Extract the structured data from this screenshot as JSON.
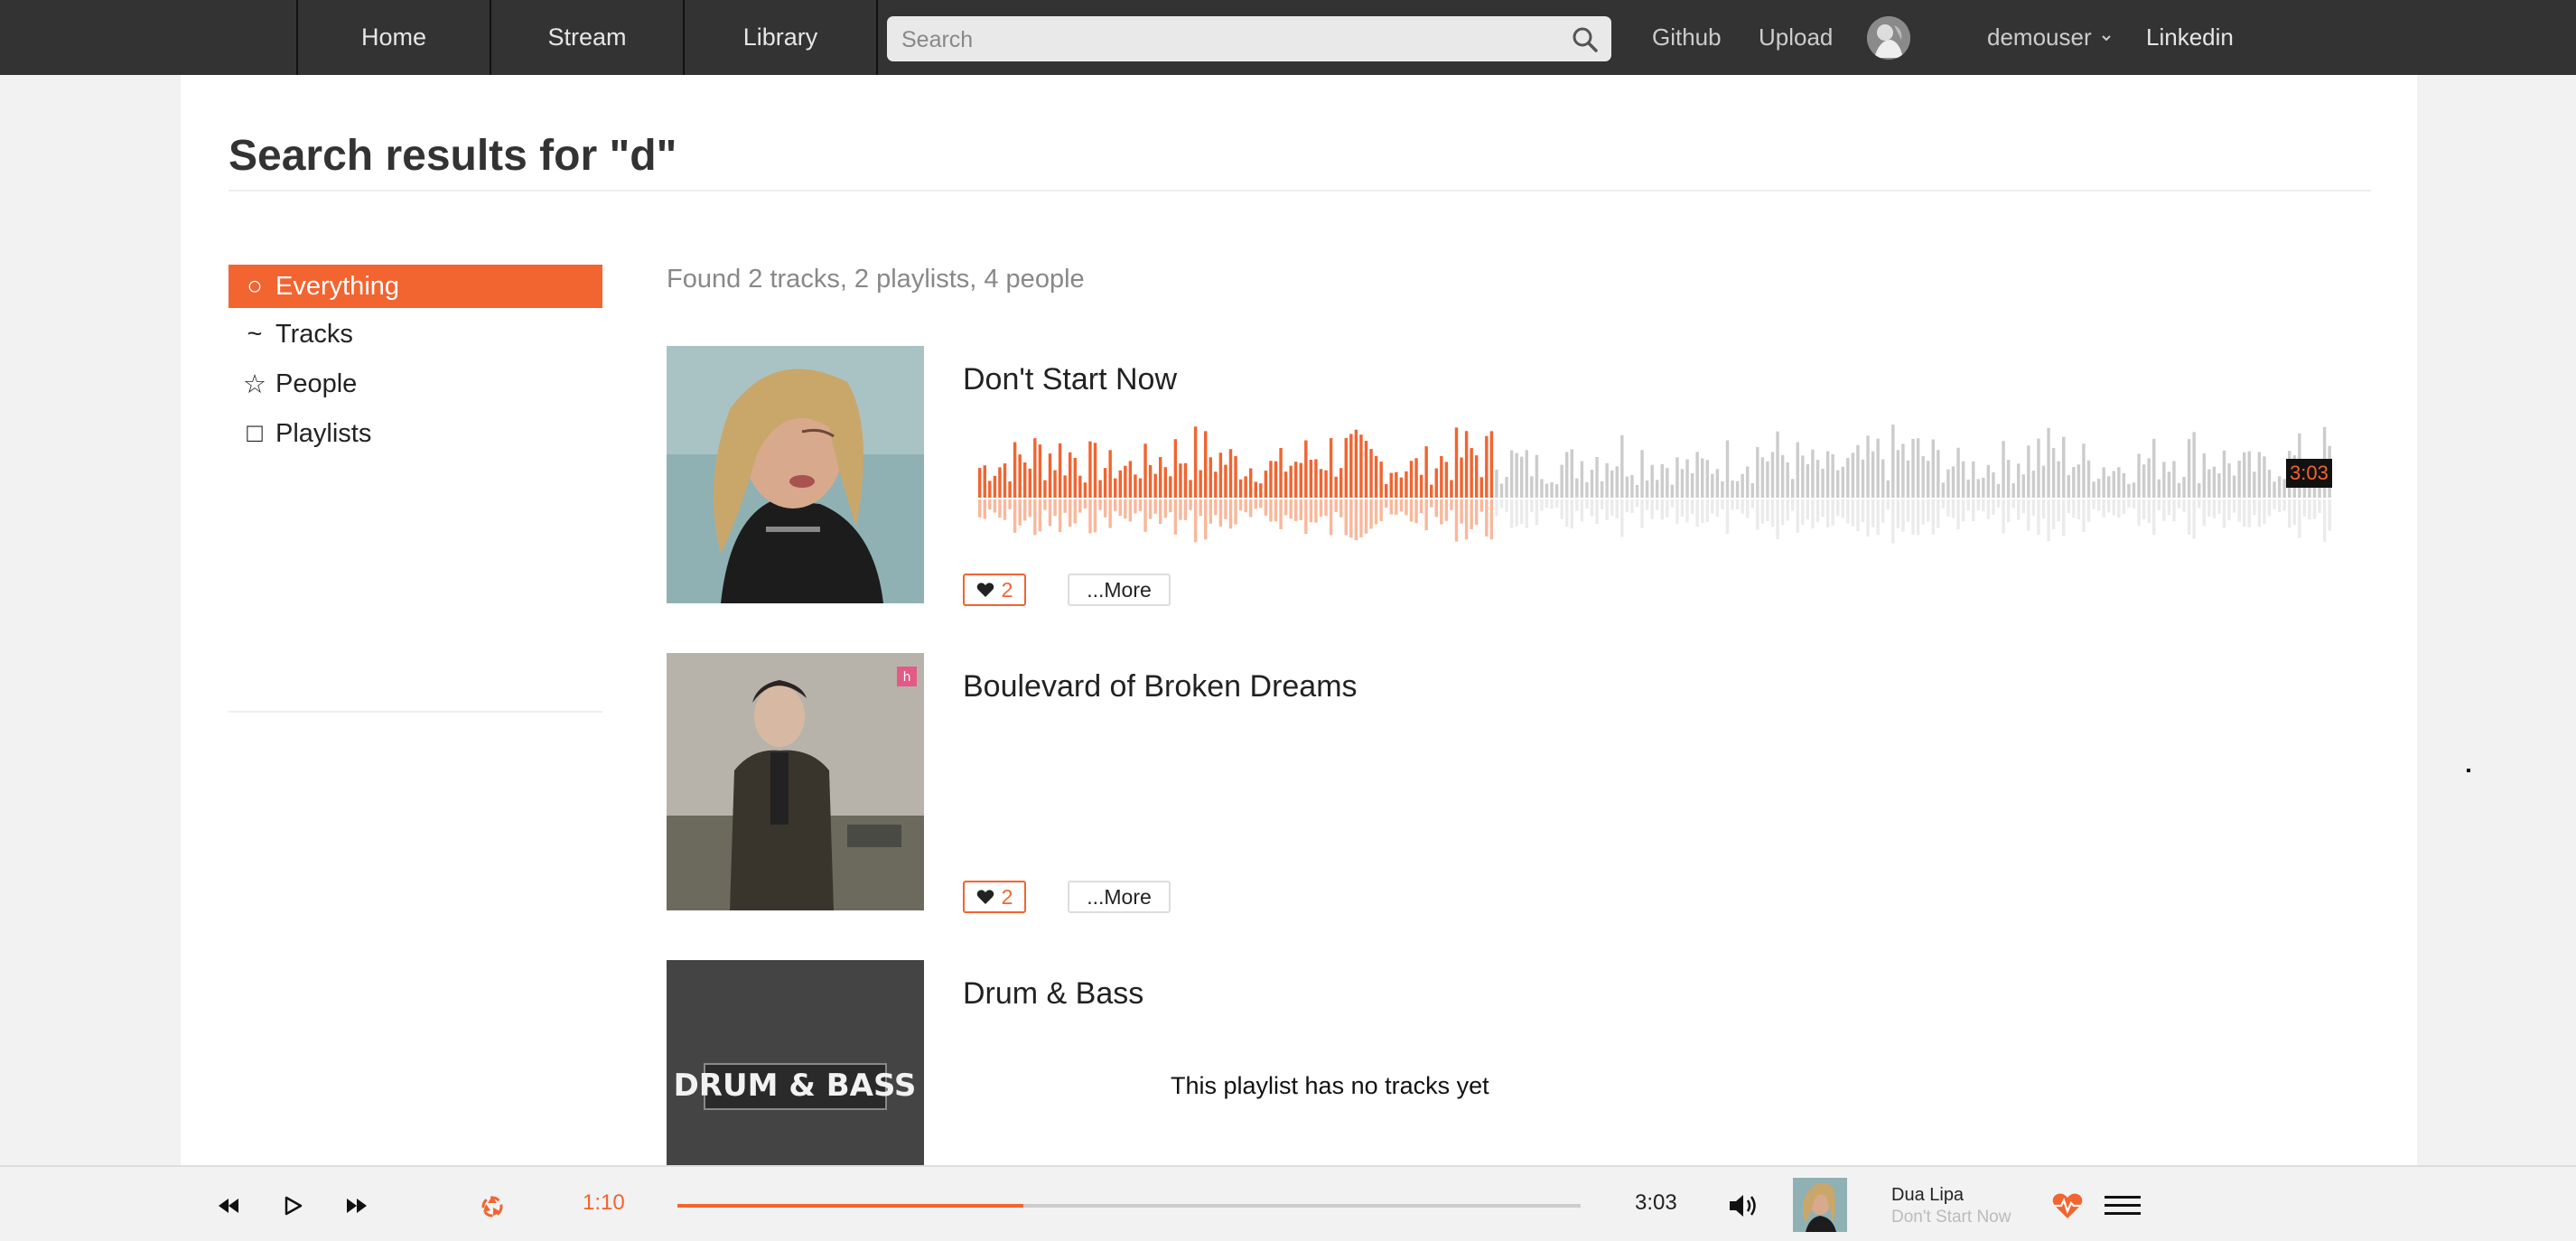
{
  "nav": {
    "tabs": [
      {
        "label": "Home"
      },
      {
        "label": "Stream"
      },
      {
        "label": "Library"
      }
    ],
    "search_placeholder": "Search",
    "links": {
      "github": "Github",
      "upload": "Upload",
      "linkedin": "Linkedin"
    },
    "user": {
      "name": "demouser",
      "menu_icon": "chevron-down-icon"
    }
  },
  "page": {
    "title": "Search results for \"d\"",
    "summary": "Found 2 tracks, 2 playlists, 4 people"
  },
  "sidebar": {
    "items": [
      {
        "label": "Everything",
        "icon": "○",
        "active": true
      },
      {
        "label": "Tracks",
        "icon": "~",
        "active": false
      },
      {
        "label": "People",
        "icon": "☆",
        "active": false
      },
      {
        "label": "Playlists",
        "icon": "□",
        "active": false
      }
    ]
  },
  "results": [
    {
      "type": "track",
      "title": "Don't Start Now",
      "likes": "2",
      "more_label": "...More",
      "duration": "3:03",
      "played_fraction": 0.38
    },
    {
      "type": "track",
      "title": "Boulevard of Broken Dreams",
      "likes": "2",
      "more_label": "...More"
    },
    {
      "type": "playlist",
      "title": "Drum & Bass",
      "cover_text": "DRUM & BASS",
      "empty_message": "This playlist has no tracks yet"
    }
  ],
  "player": {
    "current_time": "1:10",
    "total_time": "3:03",
    "progress_fraction": 0.383,
    "now_playing": {
      "artist": "Dua Lipa",
      "title": "Don't Start Now"
    }
  },
  "colors": {
    "accent": "#f26430",
    "nav_bg": "#333333",
    "page_bg": "#f2f2f2",
    "waveform_unplayed": "#cccccc"
  }
}
